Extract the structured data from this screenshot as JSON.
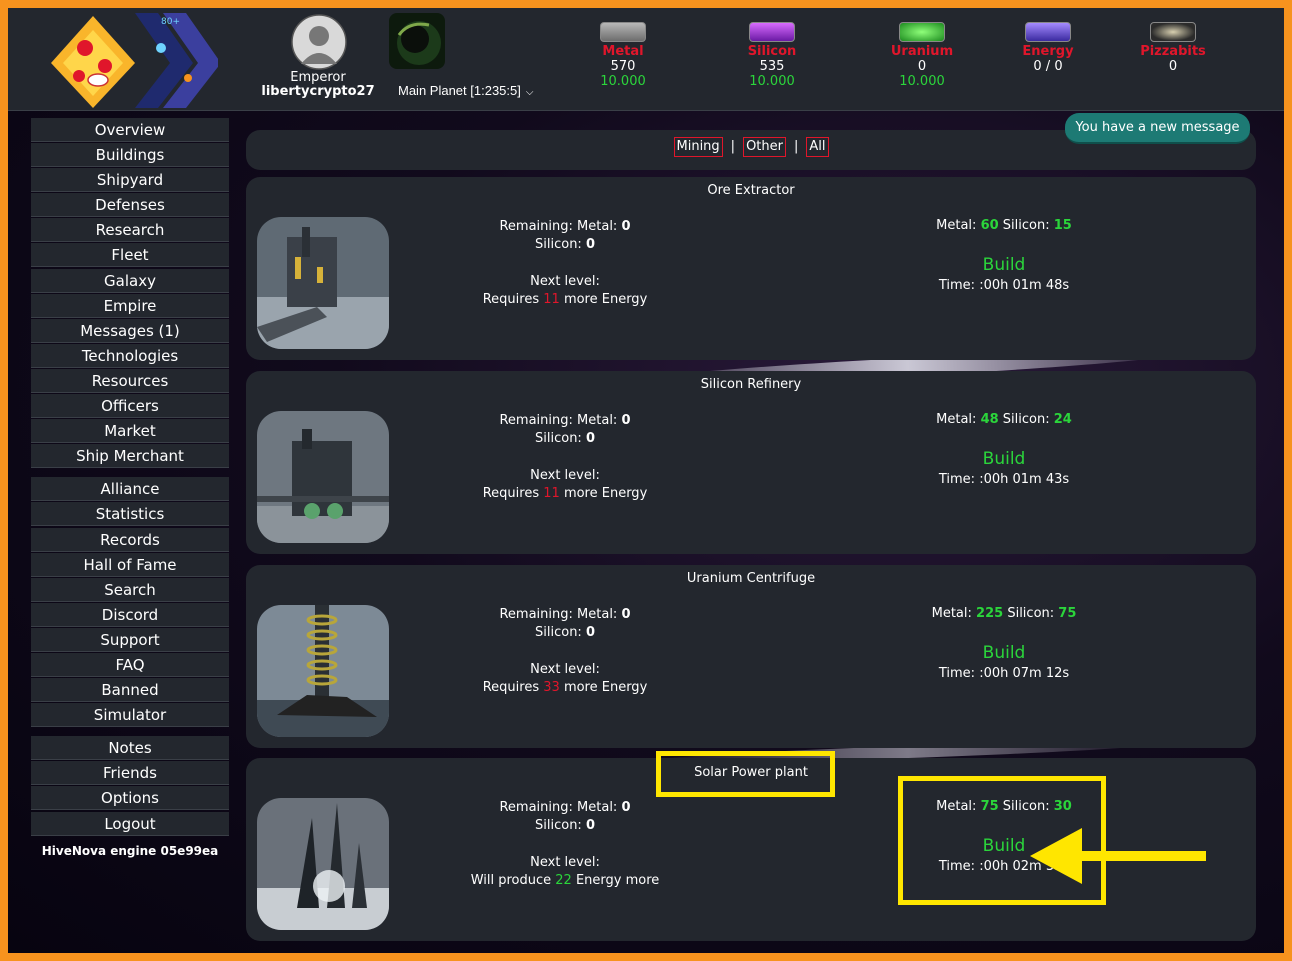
{
  "header": {
    "emperor_label": "Emperor",
    "username": "libertycrypto27",
    "planet_selector": "Main Planet [1:235:5]",
    "resources": [
      {
        "name": "Metal",
        "value": "570",
        "capacity": "10.000",
        "icon": "metal-icon"
      },
      {
        "name": "Silicon",
        "value": "535",
        "capacity": "10.000",
        "icon": "silicon-icon"
      },
      {
        "name": "Uranium",
        "value": "0",
        "capacity": "10.000",
        "icon": "uranium-icon"
      },
      {
        "name": "Energy",
        "value": "0 / 0",
        "capacity": "",
        "icon": "energy-icon"
      },
      {
        "name": "Pizzabits",
        "value": "0",
        "capacity": "",
        "icon": "pizzabits-icon"
      }
    ]
  },
  "notice": {
    "message": "You have a new message"
  },
  "sidebar": {
    "group1": [
      "Overview",
      "Buildings",
      "Shipyard",
      "Defenses",
      "Research",
      "Fleet",
      "Galaxy",
      "Empire",
      "Messages (1)",
      "Technologies",
      "Resources",
      "Officers",
      "Market",
      "Ship Merchant"
    ],
    "group2": [
      "Alliance",
      "Statistics",
      "Records",
      "Hall of Fame",
      "Search",
      "Discord",
      "Support",
      "FAQ",
      "Banned",
      "Simulator"
    ],
    "group3": [
      "Notes",
      "Friends",
      "Options",
      "Logout"
    ],
    "engine": "HiveNova engine 05e99ea"
  },
  "filters": {
    "mining": "Mining",
    "other": "Other",
    "all": "All",
    "separator": "|"
  },
  "labels": {
    "remaining": "Remaining:",
    "metal": "Metal:",
    "silicon": "Silicon:",
    "next_level": "Next level:",
    "requires": "Requires",
    "more_energy": "more Energy",
    "will_produce": "Will produce",
    "energy_more": "Energy more",
    "build": "Build",
    "time": "Time:"
  },
  "buildings": [
    {
      "name": "Ore Extractor",
      "remaining_metal": "0",
      "remaining_silicon": "0",
      "energy": "11",
      "cost_metal": "60",
      "cost_silicon": "15",
      "time": ":00h 01m 48s"
    },
    {
      "name": "Silicon Refinery",
      "remaining_metal": "0",
      "remaining_silicon": "0",
      "energy": "11",
      "cost_metal": "48",
      "cost_silicon": "24",
      "time": ":00h 01m 43s"
    },
    {
      "name": "Uranium Centrifuge",
      "remaining_metal": "0",
      "remaining_silicon": "0",
      "energy": "33",
      "cost_metal": "225",
      "cost_silicon": "75",
      "time": ":00h 07m 12s"
    },
    {
      "name": "Solar Power plant",
      "remaining_metal": "0",
      "remaining_silicon": "0",
      "energy": "22",
      "cost_metal": "75",
      "cost_silicon": "30",
      "time": ":00h 02m 31s"
    }
  ],
  "colors": {
    "frame": "#f7931e",
    "panel": "#23272e",
    "accent_green": "#2bd53b",
    "accent_red": "#e0162b",
    "highlight": "#ffe600",
    "notice": "#1d7a74"
  }
}
